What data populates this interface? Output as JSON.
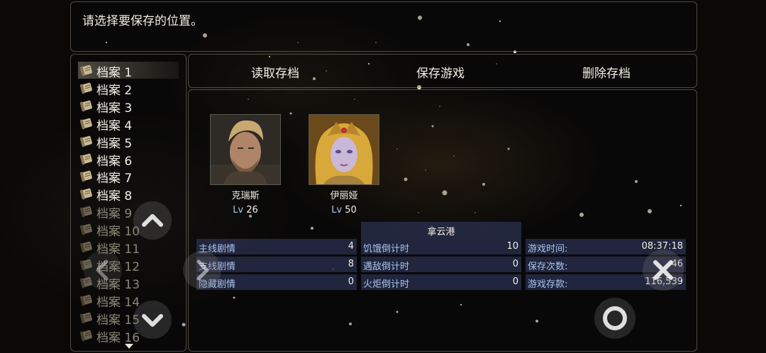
{
  "help": {
    "text": "请选择要保存的位置。"
  },
  "savefile_list": {
    "items": [
      {
        "label": "档案 1",
        "saved": true,
        "selected": true
      },
      {
        "label": "档案 2",
        "saved": true
      },
      {
        "label": "档案 3",
        "saved": true
      },
      {
        "label": "档案 4",
        "saved": true
      },
      {
        "label": "档案 5",
        "saved": true
      },
      {
        "label": "档案 6",
        "saved": true
      },
      {
        "label": "档案 7",
        "saved": true
      },
      {
        "label": "档案 8",
        "saved": true
      },
      {
        "label": "档案 9",
        "saved": false
      },
      {
        "label": "档案 10",
        "saved": false
      },
      {
        "label": "档案 11",
        "saved": false
      },
      {
        "label": "档案 12",
        "saved": false
      },
      {
        "label": "档案 13",
        "saved": false
      },
      {
        "label": "档案 14",
        "saved": false
      },
      {
        "label": "档案 15",
        "saved": false
      },
      {
        "label": "档案 16",
        "saved": false
      }
    ]
  },
  "commands": {
    "load": "读取存档",
    "save": "保存游戏",
    "delete": "删除存档"
  },
  "party": [
    {
      "name": "克瑞斯",
      "lv_label": "Lv",
      "level": "26"
    },
    {
      "name": "伊丽娅",
      "lv_label": "Lv",
      "level": "50"
    }
  ],
  "map_name": "拿云港",
  "stats": {
    "quests": [
      {
        "label": "主线剧情",
        "value": "4"
      },
      {
        "label": "支线剧情",
        "value": "8"
      },
      {
        "label": "隐藏剧情",
        "value": "0"
      }
    ],
    "timers": [
      {
        "label": "饥饿倒计时",
        "value": "10"
      },
      {
        "label": "遇敌倒计时",
        "value": "0"
      },
      {
        "label": "火炬倒计时",
        "value": "0"
      }
    ],
    "system": [
      {
        "label": "游戏时间:",
        "value": "08:37:18"
      },
      {
        "label": "保存次数:",
        "value": "46"
      },
      {
        "label": "游戏存款:",
        "value": "116,539"
      }
    ]
  },
  "colors": {
    "panel_border": "#cfc8b4",
    "stat_bg": "#282d4b",
    "label_blue": "#a9c6f0"
  },
  "icons": [
    "scroll-icon",
    "chevron-up-icon",
    "chevron-down-icon",
    "chevron-left-icon",
    "close-icon",
    "confirm-circle-icon",
    "more-down-arrow-icon"
  ]
}
